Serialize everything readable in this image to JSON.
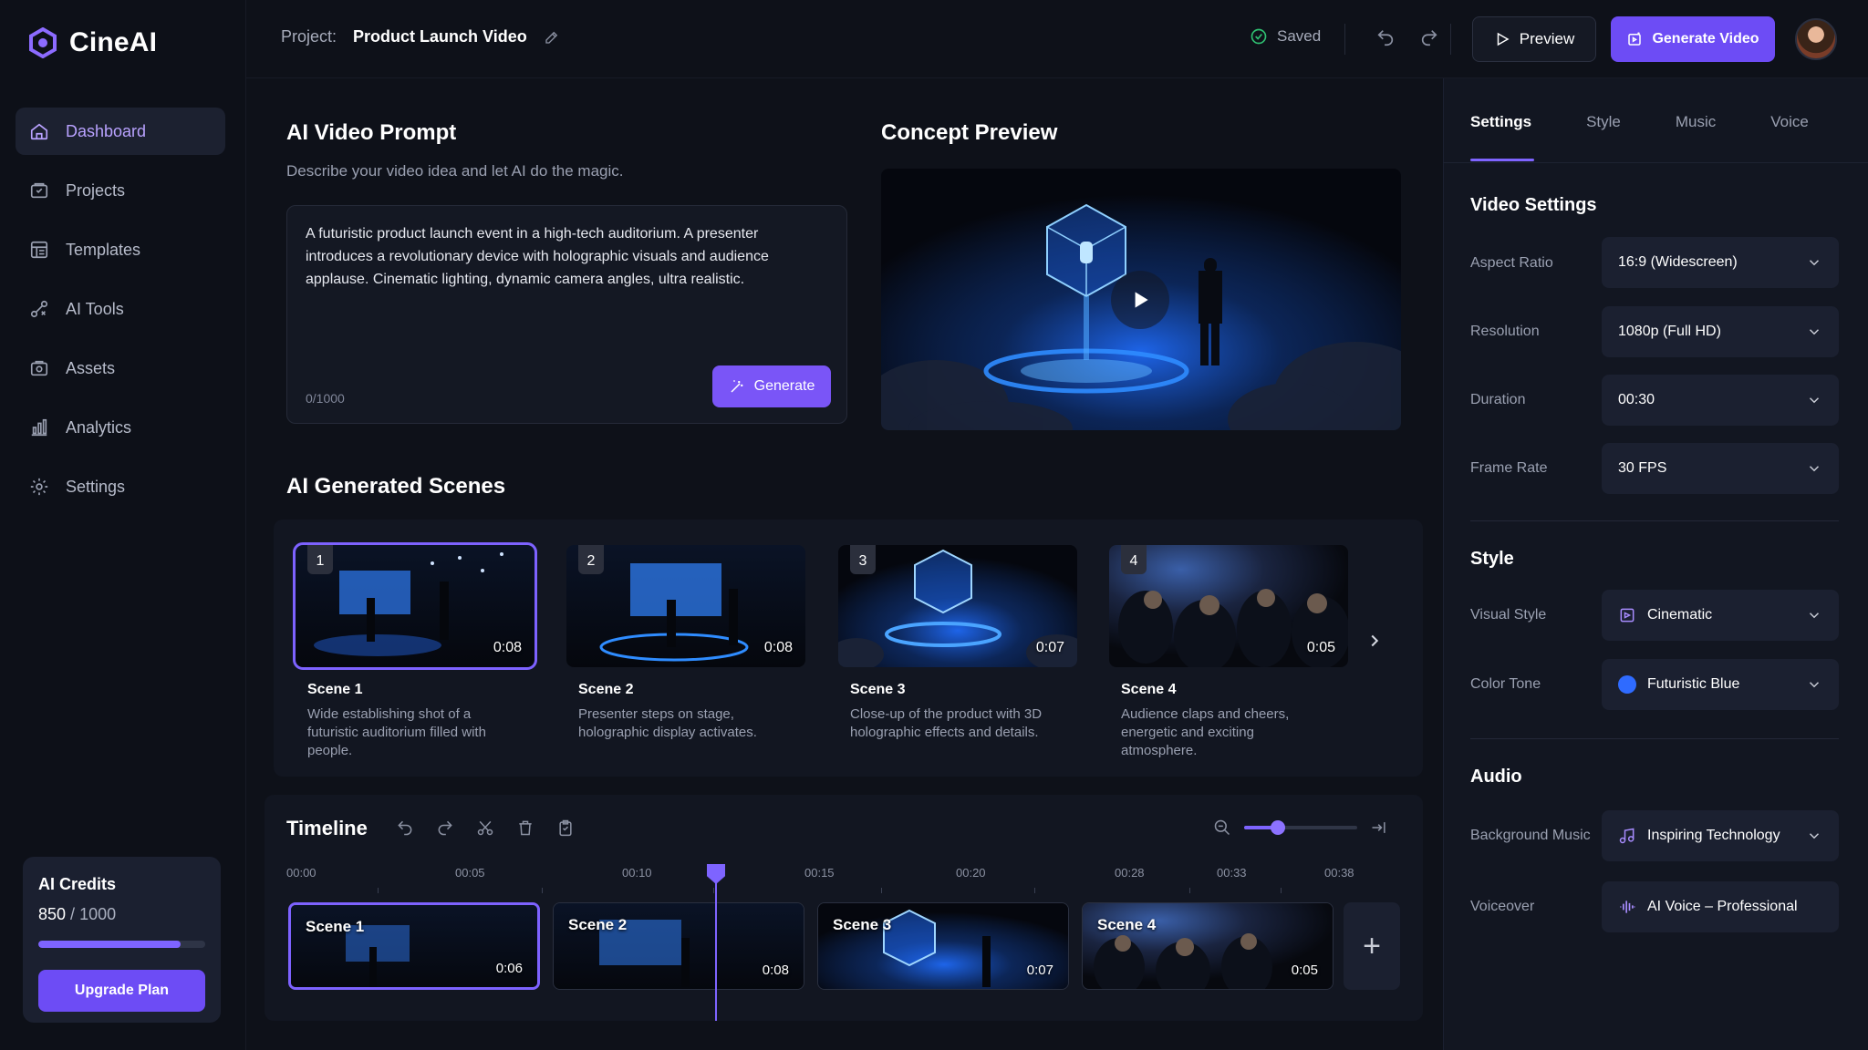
{
  "app": {
    "name": "CineAI"
  },
  "sidebar": {
    "items": [
      {
        "label": "Dashboard",
        "icon": "home-icon",
        "active": true
      },
      {
        "label": "Projects",
        "icon": "folder-icon"
      },
      {
        "label": "Templates",
        "icon": "template-icon"
      },
      {
        "label": "AI Tools",
        "icon": "ai-tools-icon"
      },
      {
        "label": "Assets",
        "icon": "assets-icon"
      },
      {
        "label": "Analytics",
        "icon": "analytics-icon"
      },
      {
        "label": "Settings",
        "icon": "gear-icon"
      }
    ],
    "credits": {
      "title": "AI Credits",
      "used": "850",
      "sep": " / ",
      "total": "1000",
      "fraction": 0.85,
      "upgrade_label": "Upgrade Plan"
    }
  },
  "header": {
    "project_label": "Project:",
    "project_name": "Product Launch Video",
    "saved_label": "Saved",
    "preview_label": "Preview",
    "generate_video_label": "Generate Video"
  },
  "prompt": {
    "title": "AI Video Prompt",
    "subtitle": "Describe your video idea and let AI do the magic.",
    "text": "A futuristic product launch event in a high-tech auditorium. A presenter introduces a revolutionary device with holographic visuals and audience applause. Cinematic lighting, dynamic camera angles, ultra realistic.",
    "counter": "0/1000",
    "generate_label": "Generate"
  },
  "concept": {
    "title": "Concept Preview"
  },
  "scenes": {
    "title": "AI Generated Scenes",
    "items": [
      {
        "number": "1",
        "duration": "0:08",
        "name": "Scene 1",
        "desc": "Wide establishing shot of a futuristic auditorium filled with people."
      },
      {
        "number": "2",
        "duration": "0:08",
        "name": "Scene 2",
        "desc": "Presenter steps on stage, holographic display activates."
      },
      {
        "number": "3",
        "duration": "0:07",
        "name": "Scene 3",
        "desc": "Close-up of the product with 3D holographic effects and details."
      },
      {
        "number": "4",
        "duration": "0:05",
        "name": "Scene 4",
        "desc": "Audience claps and cheers, energetic and exciting atmosphere."
      }
    ]
  },
  "timeline": {
    "title": "Timeline",
    "zoom_level": 0.3,
    "ticks": [
      "00:00",
      "00:05",
      "00:10",
      "00:15",
      "00:20",
      "00:28",
      "00:33",
      "00:38"
    ],
    "clips": [
      {
        "name": "Scene 1",
        "duration": "0:06"
      },
      {
        "name": "Scene 2",
        "duration": "0:08"
      },
      {
        "name": "Scene 3",
        "duration": "0:07"
      },
      {
        "name": "Scene 4",
        "duration": "0:05"
      }
    ],
    "add_label": "+"
  },
  "settings": {
    "tabs": [
      "Settings",
      "Style",
      "Music",
      "Voice"
    ],
    "video_title": "Video Settings",
    "aspect_label": "Aspect Ratio",
    "aspect_value": "16:9 (Widescreen)",
    "resolution_label": "Resolution",
    "resolution_value": "1080p (Full HD)",
    "duration_label": "Duration",
    "duration_value": "00:30",
    "framerate_label": "Frame Rate",
    "framerate_value": "30 FPS",
    "style_title": "Style",
    "visual_label": "Visual Style",
    "visual_value": "Cinematic",
    "tone_label": "Color Tone",
    "tone_value": "Futuristic Blue",
    "tone_color": "#2f6bff",
    "audio_title": "Audio",
    "music_label": "Background Music",
    "music_value": "Inspiring Technology",
    "voice_label": "Voiceover",
    "voice_value": "AI Voice – Professional"
  },
  "colors": {
    "accent": "#6d4cf5",
    "accent_light": "#7e64ff",
    "background": "#0e1119",
    "panel": "#121621"
  }
}
